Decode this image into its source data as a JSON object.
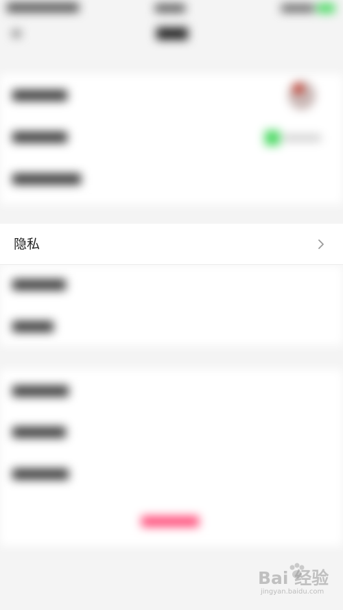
{
  "privacy_item": {
    "label": "隐私"
  },
  "watermark": {
    "brand": "Bai 经验",
    "url": "jingyan.baidu.com"
  },
  "colors": {
    "background": "#f4f4f4",
    "row_background": "#ffffff",
    "text": "#222222",
    "chevron": "#9a9a9a",
    "blurred_accent_pink": "#ff4f7b",
    "blurred_accent_green": "#4cd964"
  }
}
